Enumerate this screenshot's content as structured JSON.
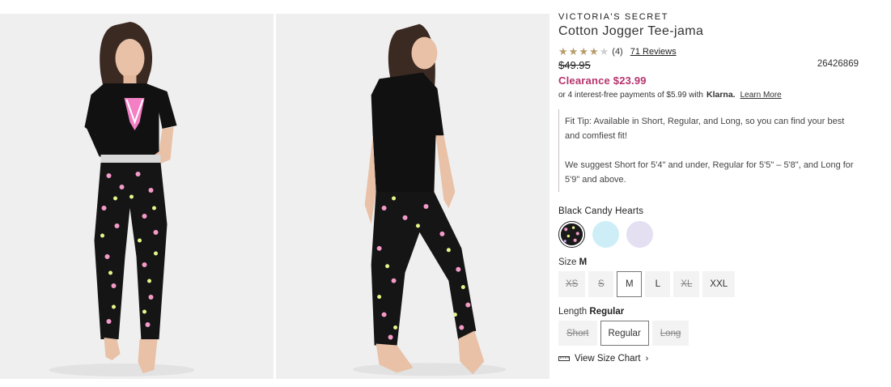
{
  "product": {
    "brand": "VICTORIA'S SECRET",
    "title": "Cotton Jogger Tee-jama",
    "rating_count": "(4)",
    "reviews_link": "71 Reviews",
    "stars": [
      1,
      1,
      1,
      1,
      0
    ],
    "original_price": "$49.95",
    "sku": "26426869",
    "clearance_price": "Clearance $23.99",
    "installments": "or 4 interest-free payments of $5.99 with",
    "klarna": "Klarna.",
    "learn_more": "Learn More"
  },
  "fit_tip": {
    "line1": "Fit Tip: Available in Short, Regular, and Long, so you can find your best and comfiest fit!",
    "line2": "We suggest Short for 5'4\" and under, Regular for 5'5\" – 5'8\", and Long for 5'9\" and above."
  },
  "color": {
    "label": "Black Candy Hearts",
    "swatch_colors": [
      "#1a1a1a",
      "#cdeef7",
      "#e4e0f2"
    ]
  },
  "size": {
    "label": "Size",
    "selected": "M",
    "options": [
      "XS",
      "S",
      "M",
      "L",
      "XL",
      "XXL"
    ]
  },
  "length": {
    "label": "Length",
    "selected": "Regular",
    "options": [
      "Short",
      "Regular",
      "Long"
    ]
  },
  "size_chart": "View Size Chart"
}
